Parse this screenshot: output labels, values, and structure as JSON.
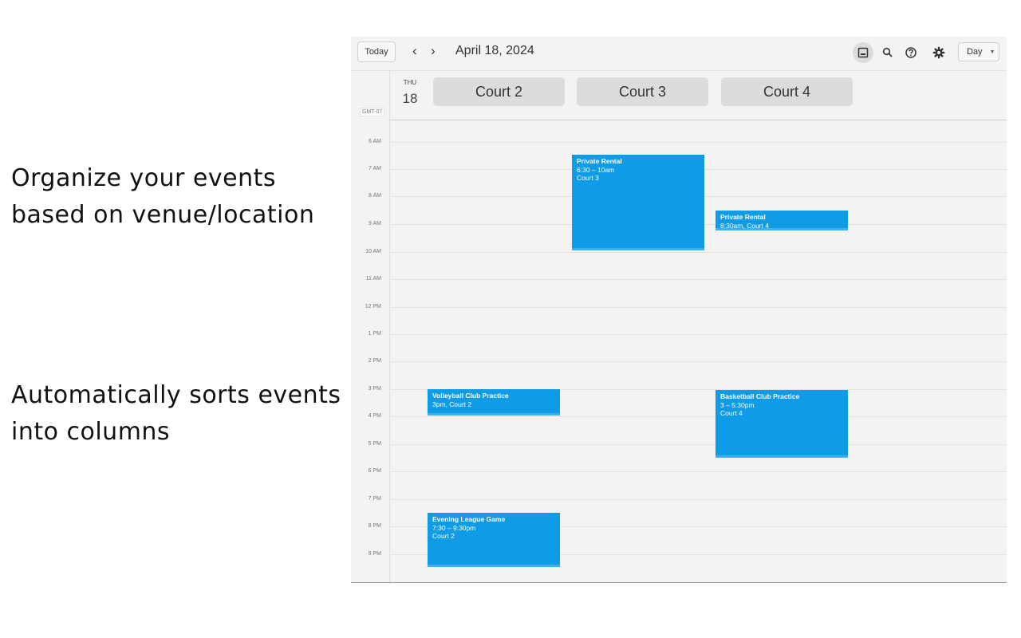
{
  "captions": [
    {
      "line1": "Organize your events",
      "line2": "based on venue/location"
    },
    {
      "line1": "Automatically sorts events",
      "line2": "into columns"
    }
  ],
  "toolbar": {
    "today_label": "Today",
    "prev_icon": "‹",
    "next_icon": "›",
    "date_title": "April 18, 2024",
    "icons": [
      "image-icon",
      "search-icon",
      "help-icon",
      "settings-icon"
    ],
    "view_label": "Day",
    "view_caret": "▼"
  },
  "day": {
    "dow": "THU",
    "num": "18",
    "timezone": "GMT-07"
  },
  "courts": [
    "Court 2",
    "Court 3",
    "Court 4"
  ],
  "hours": [
    "6 AM",
    "7 AM",
    "8 AM",
    "9 AM",
    "10 AM",
    "11 AM",
    "12 PM",
    "1 PM",
    "2 PM",
    "3 PM",
    "4 PM",
    "5 PM",
    "6 PM",
    "7 PM",
    "8 PM",
    "9 PM"
  ],
  "events": [
    {
      "title": "Private Rental",
      "line2": "6:30 – 10am",
      "line3": "Court 3"
    },
    {
      "title": "Private Rental",
      "line2": "8:30am, Court 4",
      "line3": ""
    },
    {
      "title": "Volleyball Club Practice",
      "line2": "3pm, Court 2",
      "line3": ""
    },
    {
      "title": "Basketball Club Practice",
      "line2": "3 – 5:30pm",
      "line3": "Court 4"
    },
    {
      "title": "Evening League Game",
      "line2": "7:30 – 9:30pm",
      "line3": "Court 2"
    }
  ],
  "colors": {
    "event": "#0f9be6",
    "background": "#f4f3f1"
  }
}
